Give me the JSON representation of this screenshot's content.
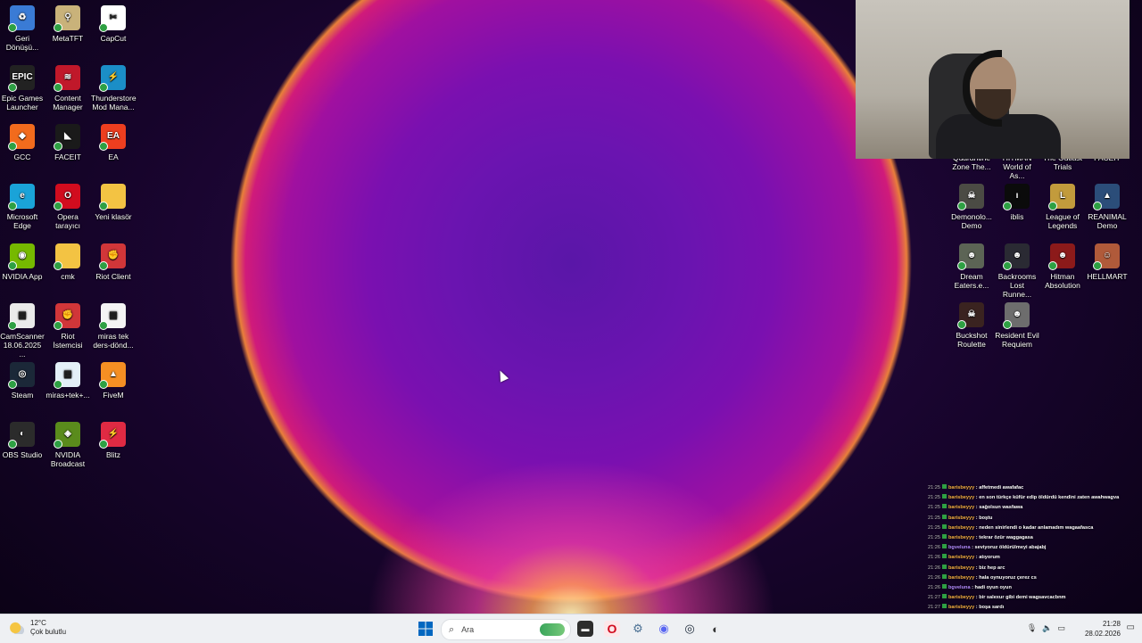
{
  "desktop_left": [
    {
      "label": "Geri Dönüşü...",
      "color": "#3a7bd5",
      "glyph": "♻"
    },
    {
      "label": "MetaTFT",
      "color": "#c9b27a",
      "glyph": "⚲"
    },
    {
      "label": "CapCut",
      "color": "#ffffff",
      "glyph": "✂"
    },
    {
      "label": "Epic Games Launcher",
      "color": "#222222",
      "glyph": "EPIC"
    },
    {
      "label": "Content Manager",
      "color": "#c0182a",
      "glyph": "≋"
    },
    {
      "label": "Thunderstore Mod Mana...",
      "color": "#1b8ec7",
      "glyph": "⚡"
    },
    {
      "label": "GCC",
      "color": "#f26b1d",
      "glyph": "◆"
    },
    {
      "label": "FACEIT",
      "color": "#1a1a1a",
      "glyph": "◣"
    },
    {
      "label": "EA",
      "color": "#ee3e1f",
      "glyph": "EA"
    },
    {
      "label": "Microsoft Edge",
      "color": "#1aa3d8",
      "glyph": "e"
    },
    {
      "label": "Opera tarayıcı",
      "color": "#d10c1e",
      "glyph": "O"
    },
    {
      "label": "Yeni klasör",
      "color": "#f3c343",
      "glyph": ""
    },
    {
      "label": "NVIDIA App",
      "color": "#76b900",
      "glyph": "◉"
    },
    {
      "label": "cmk",
      "color": "#f3c343",
      "glyph": ""
    },
    {
      "label": "Riot Client",
      "color": "#d13639",
      "glyph": "✊"
    },
    {
      "label": "CamScanner 18.06.2025 ...",
      "color": "#eaeaea",
      "glyph": "▤"
    },
    {
      "label": "Riot İstemcisi",
      "color": "#d13639",
      "glyph": "✊"
    },
    {
      "label": "miras tek ders-dönd...",
      "color": "#f4f4f4",
      "glyph": "▤"
    },
    {
      "label": "Steam",
      "color": "#1b2838",
      "glyph": "◎"
    },
    {
      "label": "miras+tek+...",
      "color": "#e4f0f8",
      "glyph": "▦"
    },
    {
      "label": "FiveM",
      "color": "#f58f23",
      "glyph": "▲"
    },
    {
      "label": "OBS Studio",
      "color": "#2b2b2b",
      "glyph": "◐"
    },
    {
      "label": "NVIDIA Broadcast",
      "color": "#5a8b1c",
      "glyph": "◈"
    },
    {
      "label": "Blitz",
      "color": "#e02a43",
      "glyph": "⚡"
    }
  ],
  "desktop_right": [
    {
      "label": "Quarantine Zone The...",
      "color": "#5a5a4a",
      "glyph": ""
    },
    {
      "label": "HITMAN World of As...",
      "color": "#3a3a3a",
      "glyph": ""
    },
    {
      "label": "The Outlast Trials",
      "color": "#3d3d3d",
      "glyph": ""
    },
    {
      "label": "FACEIT",
      "color": "#444",
      "glyph": ""
    },
    {
      "label": "Demonolo... Demo",
      "color": "#4b4b44",
      "glyph": "☠"
    },
    {
      "label": "iblis",
      "color": "#0b0b0b",
      "glyph": "ı"
    },
    {
      "label": "League of Legends",
      "color": "#c29b3c",
      "glyph": "L"
    },
    {
      "label": "REANIMAL Demo",
      "color": "#2b4d79",
      "glyph": "▲"
    },
    {
      "label": "Dream Eaters.e...",
      "color": "#5c6455",
      "glyph": "☻"
    },
    {
      "label": "Backrooms Lost Runne...",
      "color": "#2a2a33",
      "glyph": "☻"
    },
    {
      "label": "Hitman Absolution",
      "color": "#8c1a1a",
      "glyph": "☻"
    },
    {
      "label": "HELLMART",
      "color": "#b05a3a",
      "glyph": "☺"
    },
    {
      "label": "Buckshot Roulette",
      "color": "#3a2320",
      "glyph": "☠"
    },
    {
      "label": "Resident Evil Requiem",
      "color": "#6d6d6d",
      "glyph": "☻"
    }
  ],
  "chat": [
    {
      "time": "21:25",
      "user": "barisbeyyy",
      "msg": "affetmedi awafafac",
      "alt": false
    },
    {
      "time": "21:25",
      "user": "barisbeyyy",
      "msg": "en son türkçe küfür edip öldürdü kendini zaten awahwagva",
      "alt": false
    },
    {
      "time": "21:25",
      "user": "barisbeyyy",
      "msg": "sağolsun wasfawa",
      "alt": false
    },
    {
      "time": "21:25",
      "user": "barisbeyyy",
      "msg": "boştu",
      "alt": false
    },
    {
      "time": "21:25",
      "user": "barisbeyyy",
      "msg": "neden sinirlendi o kadar anlamadım wagaafasca",
      "alt": false
    },
    {
      "time": "21:25",
      "user": "barisbeyyy",
      "msg": "tekrar özür waggagasa",
      "alt": false
    },
    {
      "time": "21:26",
      "user": "bgveluna",
      "msg": "seviyoruz öldürülmeyi abajabj",
      "alt": true
    },
    {
      "time": "21:26",
      "user": "barisbeyyy",
      "msg": "atıyorum",
      "alt": false
    },
    {
      "time": "21:26",
      "user": "barisbeyyy",
      "msg": "biz hep arc",
      "alt": false
    },
    {
      "time": "21:26",
      "user": "barisbeyyy",
      "msg": "hala oynuyoruz çerez cs",
      "alt": false
    },
    {
      "time": "21:26",
      "user": "bgveluna",
      "msg": "hadi oyun oyun",
      "alt": true
    },
    {
      "time": "21:27",
      "user": "barisbeyyy",
      "msg": "bir salexur gibi demi wagsavcacbnm",
      "alt": false
    },
    {
      "time": "21:27",
      "user": "barisbeyyy",
      "msg": "boşa sardı",
      "alt": false
    },
    {
      "time": "21:27",
      "user": "barisbeyyy",
      "msg": "aynen 1 ay satırır",
      "alt": false
    },
    {
      "time": "21:27",
      "user": "barisbeyyy",
      "msg": "ne oynayacaksın",
      "alt": false
    },
    {
      "time": "21:27",
      "user": "ruken09",
      "msg": "wapedan sonra köpek gibi oynarız ları",
      "alt": true
    }
  ],
  "taskbar": {
    "weather_temp": "12°C",
    "weather_desc": "Çok bulutlu",
    "search_placeholder": "Ara",
    "time": "21:28",
    "date": "28.02.2026"
  },
  "colors": {
    "taskbar_bg": "#eef0f3",
    "accent": "#0067c0"
  }
}
